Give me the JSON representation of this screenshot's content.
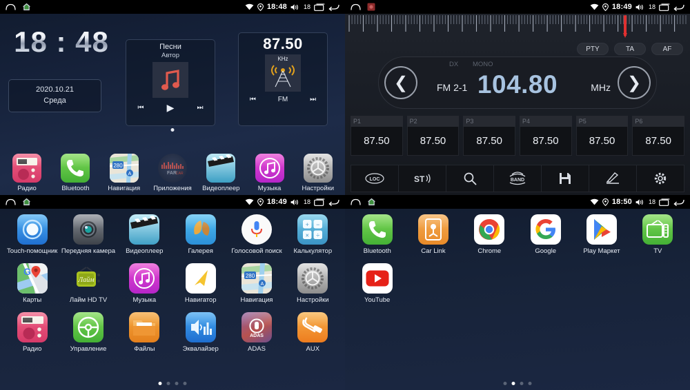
{
  "panels": {
    "home": {
      "statusbar": {
        "time": "18:48",
        "volume": "18",
        "icons": [
          "back-arch-icon",
          "home-icon",
          "wifi-icon",
          "location-icon",
          "volume-icon",
          "recents-icon",
          "back-icon"
        ]
      },
      "clock": "18 : 48",
      "date": "2020.10.21",
      "weekday": "Среда",
      "music_widget": {
        "title": "Песни",
        "artist": "Автор",
        "prev": "⏮",
        "play": "▶",
        "next": "⏭"
      },
      "radio_widget": {
        "frequency": "87.50",
        "unit": "KHz",
        "band": "FM",
        "prev": "⏮",
        "next": "⏭"
      },
      "dock": [
        {
          "label": "Радио",
          "icon": "radio-app-icon"
        },
        {
          "label": "Bluetooth",
          "icon": "phone-app-icon"
        },
        {
          "label": "Навигация",
          "icon": "maps-app-icon"
        },
        {
          "label": "Приложения",
          "icon": "apps-drawer-icon"
        },
        {
          "label": "Видеоплеер",
          "icon": "video-app-icon"
        },
        {
          "label": "Музыка",
          "icon": "music-app-icon"
        },
        {
          "label": "Настройки",
          "icon": "settings-app-icon"
        }
      ]
    },
    "radio": {
      "statusbar": {
        "time": "18:49",
        "volume": "18"
      },
      "rds_buttons": [
        "PTY",
        "TA",
        "AF"
      ],
      "dx": "DX",
      "mono": "MONO",
      "band": "FM 2-1",
      "frequency": "104.80",
      "unit": "MHz",
      "prev_arrow": "❮",
      "next_arrow": "❯",
      "presets": [
        {
          "slot": "P1",
          "value": "87.50"
        },
        {
          "slot": "P2",
          "value": "87.50"
        },
        {
          "slot": "P3",
          "value": "87.50"
        },
        {
          "slot": "P4",
          "value": "87.50"
        },
        {
          "slot": "P5",
          "value": "87.50"
        },
        {
          "slot": "P6",
          "value": "87.50"
        }
      ],
      "toolbar": [
        {
          "name": "loc-button",
          "label": "LOC"
        },
        {
          "name": "stereo-button",
          "label": "ST"
        },
        {
          "name": "scan-button",
          "label": ""
        },
        {
          "name": "band-button",
          "label": "BAND"
        },
        {
          "name": "save-button",
          "label": ""
        },
        {
          "name": "manual-tune-button",
          "label": ""
        },
        {
          "name": "settings-button",
          "label": ""
        }
      ]
    },
    "apps1": {
      "statusbar": {
        "time": "18:49",
        "volume": "18"
      },
      "apps": [
        {
          "label": "Touch-помощник",
          "icon": "touch-assistant-icon"
        },
        {
          "label": "Передняя камера",
          "icon": "front-camera-icon"
        },
        {
          "label": "Видеоплеер",
          "icon": "video-player-icon"
        },
        {
          "label": "Галерея",
          "icon": "gallery-icon"
        },
        {
          "label": "Голосовой поиск",
          "icon": "voice-search-icon"
        },
        {
          "label": "Калькулятор",
          "icon": "calculator-icon"
        },
        {
          "label": "Карты",
          "icon": "google-maps-icon"
        },
        {
          "label": "Лайм HD TV",
          "icon": "lime-hd-tv-icon"
        },
        {
          "label": "Музыка",
          "icon": "music-icon"
        },
        {
          "label": "Навигатор",
          "icon": "navigator-icon"
        },
        {
          "label": "Навигация",
          "icon": "navigation-maps-icon"
        },
        {
          "label": "Настройки",
          "icon": "settings-icon"
        },
        {
          "label": "Радио",
          "icon": "radio-icon"
        },
        {
          "label": "Управление",
          "icon": "steering-wheel-icon"
        },
        {
          "label": "Файлы",
          "icon": "files-folder-icon"
        },
        {
          "label": "Эквалайзер",
          "icon": "equalizer-icon"
        },
        {
          "label": "ADAS",
          "icon": "adas-icon"
        },
        {
          "label": "AUX",
          "icon": "aux-jack-icon"
        }
      ],
      "page_dots": {
        "count": 4,
        "active": 0
      }
    },
    "apps2": {
      "statusbar": {
        "time": "18:50",
        "volume": "18"
      },
      "apps": [
        {
          "label": "Bluetooth",
          "icon": "phone-icon"
        },
        {
          "label": "Car Link",
          "icon": "car-link-icon"
        },
        {
          "label": "Chrome",
          "icon": "chrome-icon"
        },
        {
          "label": "Google",
          "icon": "google-icon"
        },
        {
          "label": "Play Маркет",
          "icon": "play-store-icon"
        },
        {
          "label": "TV",
          "icon": "tv-icon"
        },
        {
          "label": "YouTube",
          "icon": "youtube-icon"
        }
      ],
      "page_dots": {
        "count": 4,
        "active": 1
      }
    }
  },
  "colors": {
    "accent_blue": "#a8c3e0",
    "needle_red": "#e03030",
    "home_bg": "#16223b",
    "radio_bg": "#1b1f27"
  }
}
